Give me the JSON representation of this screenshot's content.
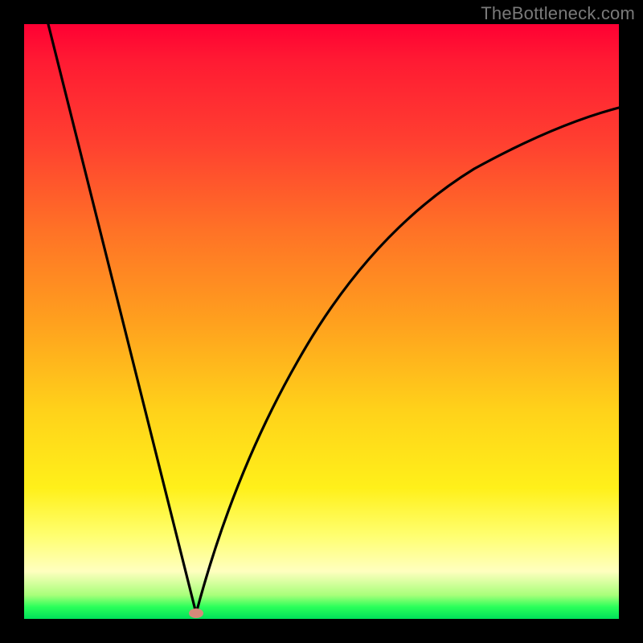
{
  "watermark": "TheBottleneck.com",
  "colors": {
    "frame": "#000000",
    "gradient_top": "#ff0033",
    "gradient_bottom": "#00e05a",
    "curve": "#000000",
    "dot": "#d68a7a"
  },
  "chart_data": {
    "type": "line",
    "title": "",
    "xlabel": "",
    "ylabel": "",
    "xlim": [
      0,
      100
    ],
    "ylim": [
      0,
      100
    ],
    "grid": false,
    "legend": false,
    "annotations": [],
    "dot": {
      "x": 29,
      "y": 1
    },
    "series": [
      {
        "name": "left-branch",
        "x": [
          4,
          7,
          10,
          13,
          16,
          19,
          22,
          25,
          27,
          29
        ],
        "y": [
          100,
          88,
          76,
          64,
          52,
          40,
          28,
          16,
          8,
          1
        ]
      },
      {
        "name": "right-branch",
        "x": [
          29,
          31,
          34,
          38,
          42,
          47,
          53,
          60,
          68,
          77,
          87,
          100
        ],
        "y": [
          1,
          10,
          22,
          34,
          44,
          53,
          61,
          68,
          74,
          79,
          83,
          86
        ]
      }
    ]
  }
}
